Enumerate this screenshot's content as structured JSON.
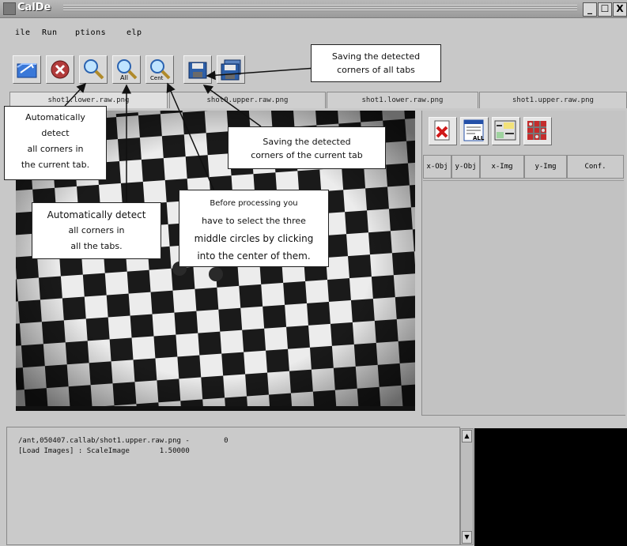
{
  "window": {
    "title": "CalDe",
    "controls": [
      "_",
      "☐",
      "X"
    ]
  },
  "menu": {
    "items": [
      "ile",
      "Run",
      "ptions",
      "elp"
    ]
  },
  "toolbar": {
    "buttons": [
      {
        "name": "open-folder",
        "icon": "folder-open-icon"
      },
      {
        "name": "stop",
        "icon": "stop-icon"
      },
      {
        "name": "detect-current",
        "icon": "magnifier-icon"
      },
      {
        "name": "detect-all",
        "icon": "magnifier-all-icon",
        "label": "All"
      },
      {
        "name": "select-center",
        "icon": "magnifier-center-icon",
        "label": "Cent"
      },
      {
        "name": "save-current",
        "icon": "floppy-save-icon"
      },
      {
        "name": "save-all",
        "icon": "floppy-save-all-icon"
      }
    ]
  },
  "tabs": [
    {
      "label": "shot1.lower.raw.png"
    },
    {
      "label": "shot0.upper.raw.png"
    },
    {
      "label": "shot1.lower.raw.png"
    },
    {
      "label": "shot1.upper.raw.png"
    }
  ],
  "side_panel": {
    "buttons": [
      {
        "name": "delete-points",
        "icon": "delete-icon"
      },
      {
        "name": "all-points",
        "icon": "table-all-icon",
        "label": "ALL"
      },
      {
        "name": "point-list",
        "icon": "point-list-icon"
      },
      {
        "name": "mosaic",
        "icon": "mosaic-icon"
      }
    ],
    "columns": [
      "x-Obj",
      "y-Obj",
      "x-Img",
      "y-Img",
      "Conf."
    ]
  },
  "log": {
    "lines": [
      "/ant,050407.callab/shot1.upper.raw.png -        0",
      "[Load Images] : ScaleImage       1.50000"
    ]
  },
  "callouts": {
    "save_all": [
      "Saving the detected",
      "corners of all tabs"
    ],
    "detect_current": [
      "Automatically",
      "detect",
      "all corners in",
      "the current tab."
    ],
    "save_current": [
      "Saving the detected",
      "corners of the current tab"
    ],
    "detect_all": [
      "Automatically detect",
      "all corners in",
      "all the tabs."
    ],
    "select_center": [
      "Before processing you",
      "have to select the three",
      "middle circles by clicking",
      "into the center of them."
    ]
  },
  "colors": {
    "background": "#c8c8c8",
    "accent_blue": "#1f5fd1",
    "stop_red": "#b23b3b"
  }
}
